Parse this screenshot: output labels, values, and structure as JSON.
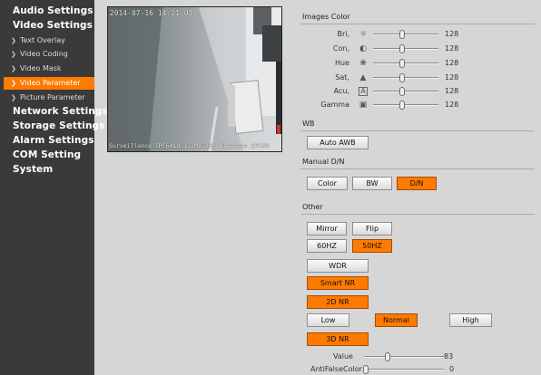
{
  "sidebar": {
    "audio": "Audio Settings",
    "video": "Video Settings",
    "video_items": [
      {
        "label": "Text Overlay"
      },
      {
        "label": "Video Coding"
      },
      {
        "label": "Video Mask"
      },
      {
        "label": "Video Parameter"
      },
      {
        "label": "Picture Parameter"
      }
    ],
    "network": "Network Settings",
    "storage": "Storage Settings",
    "alarm": "Alarm Settings",
    "com": "COM Setting",
    "system": "System"
  },
  "video": {
    "timestamp": "2014-07-16 14:21:01",
    "caption": "Surveillance IPC6418 1.3M 720P Wireless IPCAM"
  },
  "image_color": {
    "title": "Images Color",
    "rows": [
      {
        "label": "Bri,",
        "icon": "brightness-icon",
        "value": "128",
        "level": 0.5
      },
      {
        "label": "Con,",
        "icon": "contrast-icon",
        "value": "128",
        "level": 0.5
      },
      {
        "label": "Hue",
        "icon": "hue-icon",
        "value": "128",
        "level": 0.5
      },
      {
        "label": "Sat,",
        "icon": "saturation-icon",
        "value": "128",
        "level": 0.5
      },
      {
        "label": "Acu,",
        "icon": "sharpness-icon",
        "value": "128",
        "level": 0.5
      },
      {
        "label": "Gamma",
        "icon": "gamma-icon",
        "value": "128",
        "level": 0.5
      }
    ]
  },
  "wb": {
    "title": "WB",
    "auto_awb": "Auto AWB"
  },
  "manual_dn": {
    "title": "Manual D/N",
    "color": "Color",
    "bw": "BW",
    "dn": "D/N"
  },
  "other": {
    "title": "Other",
    "mirror": "Mirror",
    "flip": "Flip",
    "hz60": "60HZ",
    "hz50": "50HZ",
    "wdr": "WDR",
    "smart_nr": "Smart NR",
    "nr2d": "2D NR",
    "low": "Low",
    "normal": "Normal",
    "high": "High",
    "nr3d": "3D NR",
    "value_label": "Value",
    "value": "83",
    "value_level": 0.34,
    "antifalse_label": "AntiFalseColor",
    "antifalse_value": "0",
    "antifalse_level": 0
  },
  "colors": {
    "accent": "#ff7a00",
    "sidebar_bg": "#3a3a3a",
    "panel_bg": "#d6d6d6"
  }
}
